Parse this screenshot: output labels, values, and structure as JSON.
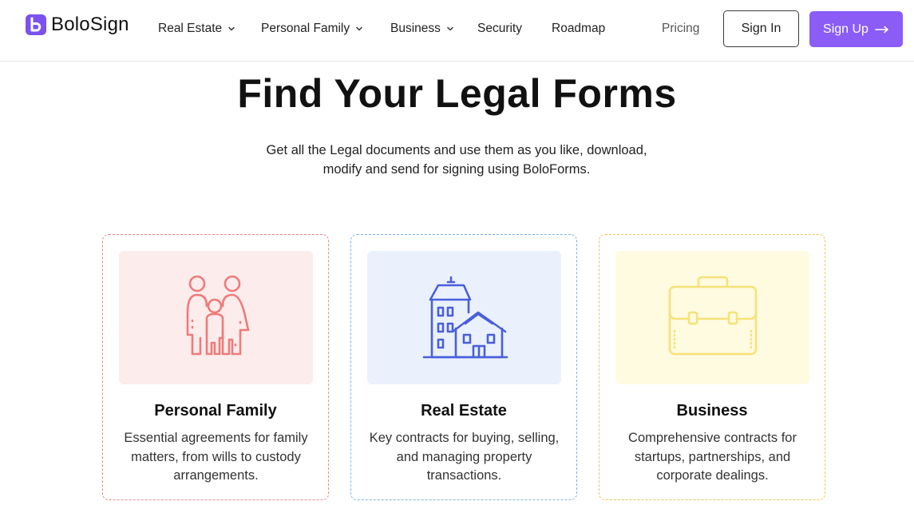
{
  "brand": {
    "name": "BoloSign",
    "color": "#7b52f0"
  },
  "nav": {
    "items": [
      {
        "label": "Real Estate",
        "dropdown": true
      },
      {
        "label": "Personal Family",
        "dropdown": true
      },
      {
        "label": "Business",
        "dropdown": true
      },
      {
        "label": "Security",
        "dropdown": false
      },
      {
        "label": "Roadmap",
        "dropdown": false
      }
    ],
    "pricing": "Pricing",
    "sign_in": "Sign In",
    "sign_up": "Sign Up",
    "accent": "#8b5cf6"
  },
  "hero": {
    "title": "Find Your Legal Forms",
    "subtitle_line1": "Get all the Legal documents and use them as you like, download,",
    "subtitle_line2": "modify and send for signing using BoloForms."
  },
  "cards": [
    {
      "title": "Personal Family",
      "desc": "Essential agreements for family matters, from wills to custody arrangements.",
      "icon": "family-icon",
      "border": "#e88a8a",
      "bg": "#fdecec",
      "stroke": "#f07a7a"
    },
    {
      "title": "Real Estate",
      "desc": "Key contracts for buying, selling, and managing property transactions.",
      "icon": "buildings-icon",
      "border": "#7ab3e6",
      "bg": "#eaf1fd",
      "stroke": "#4a5fdc"
    },
    {
      "title": "Business",
      "desc": "Comprehensive contracts for startups, partnerships, and corporate dealings.",
      "icon": "briefcase-icon",
      "border": "#f0c65a",
      "bg": "#fefbe0",
      "stroke": "#f5e27a"
    }
  ]
}
